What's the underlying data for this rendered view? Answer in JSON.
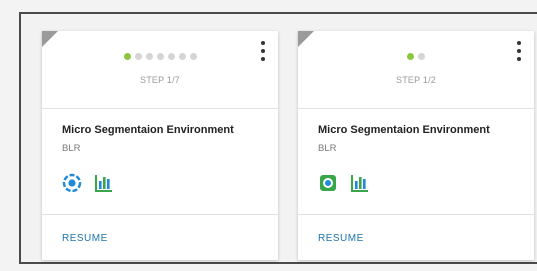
{
  "cards": [
    {
      "step_label": "STEP 1/7",
      "progress": {
        "current": 1,
        "total": 7
      },
      "title": "Micro Segmentaion Environment",
      "location": "BLR",
      "action_label": "RESUME",
      "icons": [
        "target-ring-icon",
        "bar-chart-icon"
      ]
    },
    {
      "step_label": "STEP 1/2",
      "progress": {
        "current": 1,
        "total": 2
      },
      "title": "Micro Segmentaion Environment",
      "location": "BLR",
      "action_label": "RESUME",
      "icons": [
        "target-square-icon",
        "bar-chart-icon"
      ]
    }
  ],
  "colors": {
    "active_dot": "#8cc63f",
    "inactive_dot": "#d5d5d5",
    "link": "#1a73a8",
    "icon_blue": "#1f8ad8",
    "icon_green": "#3aa64b"
  }
}
